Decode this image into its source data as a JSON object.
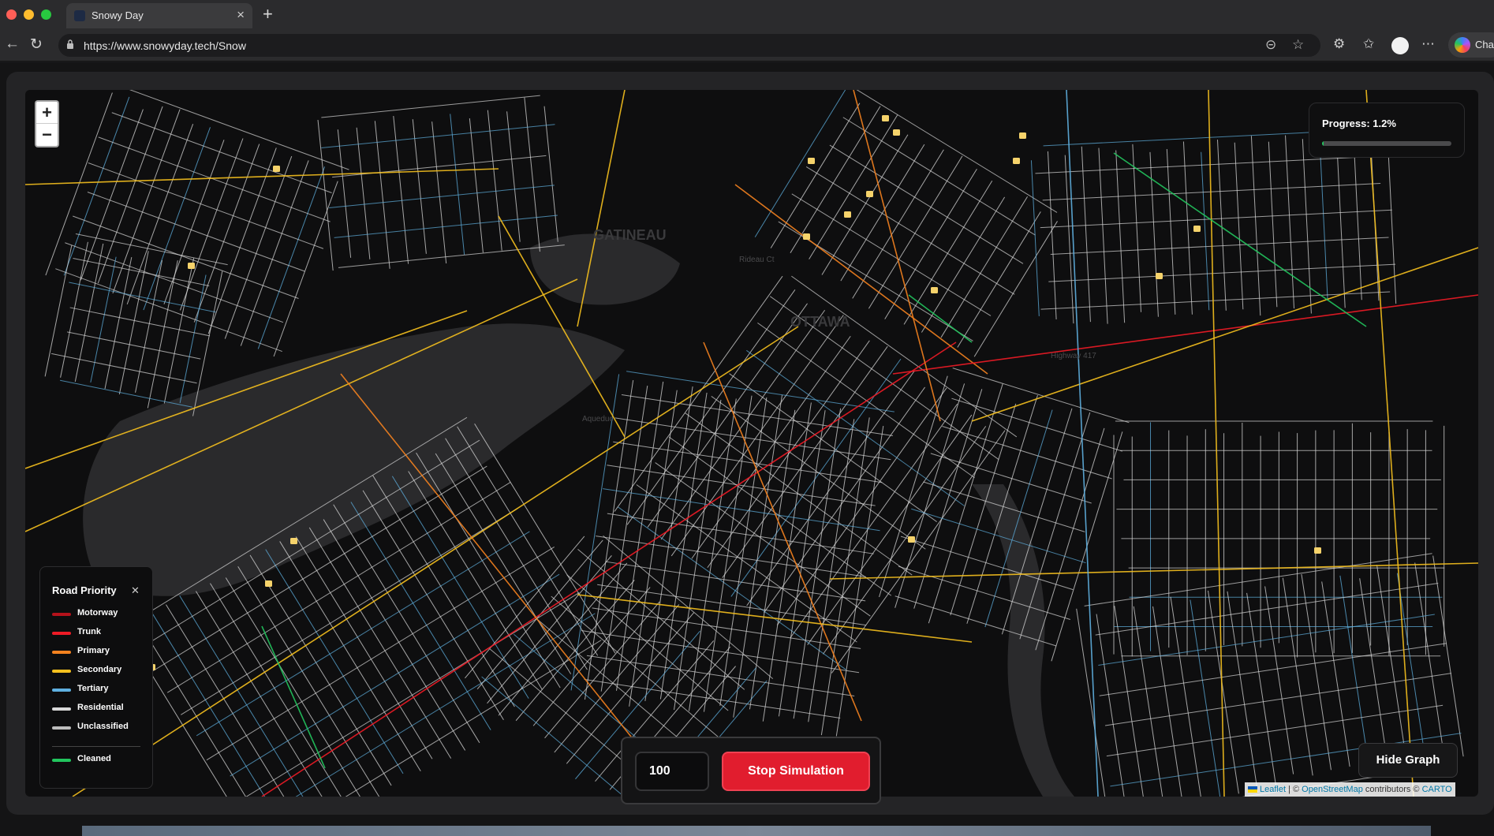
{
  "browser": {
    "tab_title": "Snowy Day",
    "url": "https://www.snowyday.tech/Snow",
    "copilot_label": "Cha"
  },
  "map": {
    "zoom_in": "+",
    "zoom_out": "−",
    "labels": [
      "GATINEAU",
      "OTTAWA",
      "Highway 417",
      "Rideau Ct",
      "Aqueduc"
    ],
    "attribution": {
      "leaflet": "Leaflet",
      "sep": " | © ",
      "osm": "OpenStreetMap",
      "contrib": " contributors © ",
      "carto": "CARTO"
    }
  },
  "progress": {
    "label": "Progress: 1.2%",
    "value": 0.012
  },
  "legend": {
    "title": "Road Priority",
    "close": "✕",
    "items": [
      {
        "label": "Motorway",
        "color": "#b5121b"
      },
      {
        "label": "Trunk",
        "color": "#ef1b26"
      },
      {
        "label": "Primary",
        "color": "#f4821f"
      },
      {
        "label": "Secondary",
        "color": "#f5c01e"
      },
      {
        "label": "Tertiary",
        "color": "#5fb0e0"
      },
      {
        "label": "Residential",
        "color": "#d9d9d9"
      },
      {
        "label": "Unclassified",
        "color": "#bdbdbd"
      },
      {
        "label": "Cleaned",
        "color": "#22c55e"
      }
    ]
  },
  "controls": {
    "speed_value": "100",
    "stop_label": "Stop Simulation",
    "hide_graph_label": "Hide Graph"
  }
}
